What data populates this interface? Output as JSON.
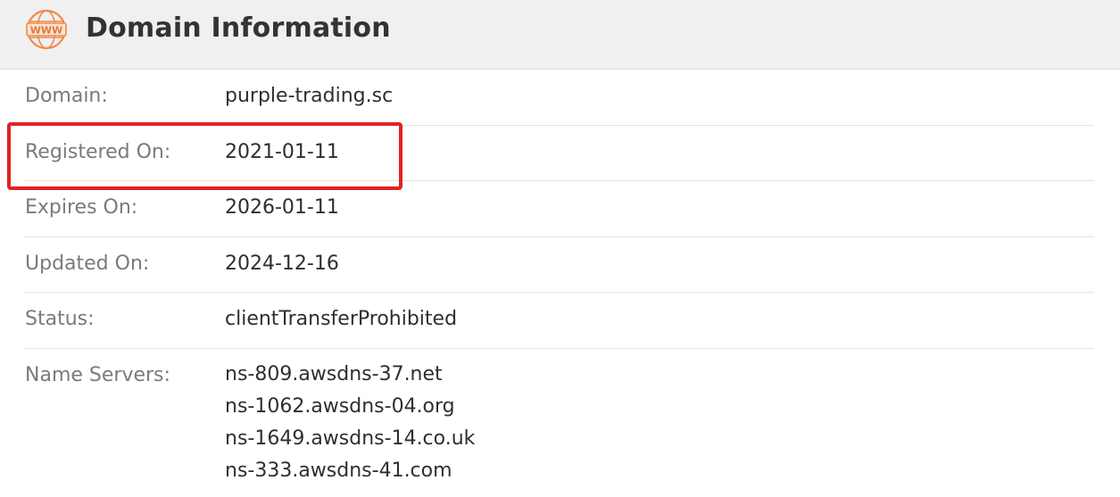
{
  "header": {
    "icon": "www-icon",
    "icon_text": "WWW",
    "title": "Domain Information"
  },
  "rows": [
    {
      "label": "Domain:",
      "value": "purple-trading.sc"
    },
    {
      "label": "Registered On:",
      "value": "2021-01-11"
    },
    {
      "label": "Expires On:",
      "value": "2026-01-11"
    },
    {
      "label": "Updated On:",
      "value": "2024-12-16"
    },
    {
      "label": "Status:",
      "value": "clientTransferProhibited"
    }
  ],
  "name_servers": {
    "label": "Name Servers:",
    "values": [
      "ns-809.awsdns-37.net",
      "ns-1062.awsdns-04.org",
      "ns-1649.awsdns-14.co.uk",
      "ns-333.awsdns-41.com"
    ]
  },
  "colors": {
    "accent": "#f08a4b",
    "highlight_box": "#e02424",
    "header_bg": "#f0f0f0"
  }
}
